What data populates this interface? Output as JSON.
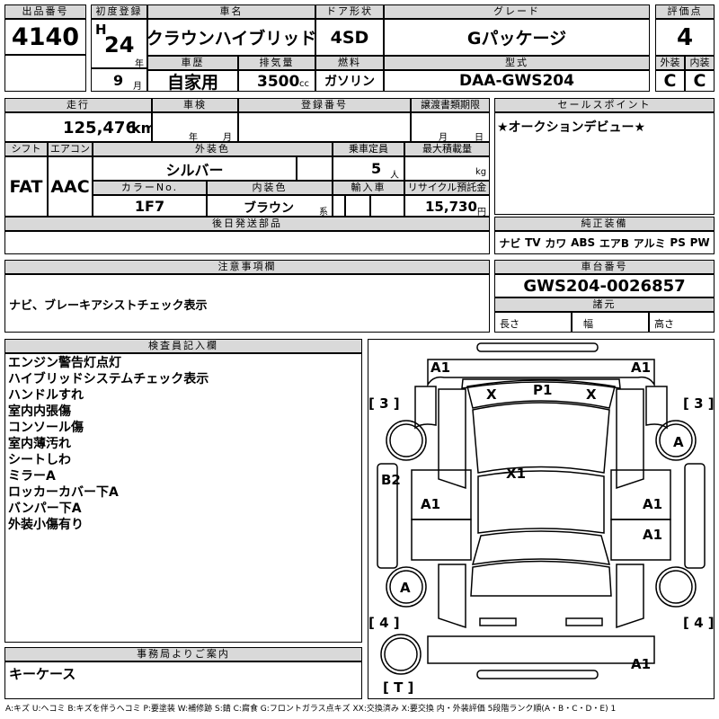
{
  "lot": {
    "label": "出品番号",
    "value": "4140"
  },
  "first_reg": {
    "label": "初度登録",
    "era": "H",
    "year": "24",
    "year_unit": "年",
    "month": "9",
    "month_unit": "月"
  },
  "car_name": {
    "label": "車名",
    "value": "クラウンハイブリッド"
  },
  "door": {
    "label": "ドア形状",
    "value": "4SD"
  },
  "grade": {
    "label": "グレード",
    "value": "Gパッケージ"
  },
  "score": {
    "label": "評価点",
    "value": "4",
    "ext_label": "外装",
    "int_label": "内装",
    "ext_value": "C",
    "int_value": "C"
  },
  "history": {
    "label": "車歴",
    "value": "自家用"
  },
  "displacement": {
    "label": "排気量",
    "value": "3500",
    "unit": "cc"
  },
  "fuel": {
    "label": "燃料",
    "value": "ガソリン"
  },
  "model_code": {
    "label": "型式",
    "value": "DAA-GWS204"
  },
  "mileage": {
    "label": "走行",
    "value": "125,476",
    "unit": "km"
  },
  "inspection": {
    "label": "車検",
    "year_unit": "年",
    "month_unit": "月"
  },
  "reg_no": {
    "label": "登録番号"
  },
  "transfer_deadline": {
    "label": "譲渡書類期限",
    "month_unit": "月",
    "day_unit": "日"
  },
  "sales_point": {
    "label": "セールスポイント",
    "value": "★オークションデビュー★"
  },
  "shift": {
    "label": "シフト",
    "value": "FAT"
  },
  "aircon": {
    "label": "エアコン",
    "value": "AAC"
  },
  "ext_color": {
    "label": "外装色",
    "value": "シルバー"
  },
  "capacity": {
    "label": "乗車定員",
    "value": "5",
    "unit": "人"
  },
  "max_load": {
    "label": "最大積載量",
    "unit": "kg"
  },
  "color_no": {
    "label": "カラーNo.",
    "value": "1F7"
  },
  "int_color": {
    "label": "内装色",
    "value": "ブラウン",
    "unit": "系"
  },
  "import": {
    "label": "輸入車"
  },
  "recycle": {
    "label": "リサイクル預託金",
    "value": "15,730",
    "unit": "円"
  },
  "later_parts": {
    "label": "後日発送部品"
  },
  "genuine_equipment": {
    "label": "純正装備",
    "items": [
      "ナビ",
      "TV",
      "カワ",
      "ABS",
      "エアB",
      "アルミ",
      "PS",
      "PW"
    ]
  },
  "caution": {
    "label": "注意事項欄",
    "value": "ナビ、ブレーキアシストチェック表示"
  },
  "chassis": {
    "label": "車台番号",
    "value": "GWS204-0026857"
  },
  "specs": {
    "label": "諸元",
    "length": "長さ",
    "width": "幅",
    "height": "高さ"
  },
  "inspector": {
    "label": "検査員記入欄",
    "notes": [
      "エンジン警告灯点灯",
      "ハイブリッドシステムチェック表示",
      "ハンドルすれ",
      "室内内張傷",
      "コンソール傷",
      "室内薄汚れ",
      "シートしわ",
      "ミラーA",
      "ロッカーカバー下A",
      "バンパー下A",
      "外装小傷有り"
    ]
  },
  "office": {
    "label": "事務局よりご案内",
    "value": "キーケース"
  },
  "diagram": {
    "front_left": "A1",
    "front_right": "A1",
    "windshield_left": "X",
    "windshield_mid": "P1",
    "windshield_right": "X",
    "side_left": "[ 3 ]",
    "side_right": "[ 3 ]",
    "front_wheel_right": "A",
    "left_fender": "B2",
    "roof": "X1",
    "left_door": "A1",
    "right_door_front": "A1",
    "right_door_rear": "A1",
    "rear_wheel_left": "A",
    "rear_side_left": "[ 4 ]",
    "rear_side_right": "[ 4 ]",
    "rear_right": "A1",
    "trunk": "[ T ]"
  },
  "legend": "A:キズ U:ヘコミ B:キズを伴うヘコミ P:要塗装 W:補修跡 S:錆 C:腐食 G:フロントガラス点キズ XX:交換済み X:要交換 内・外装評価 5段階ランク順(A・B・C・D・E) 1"
}
